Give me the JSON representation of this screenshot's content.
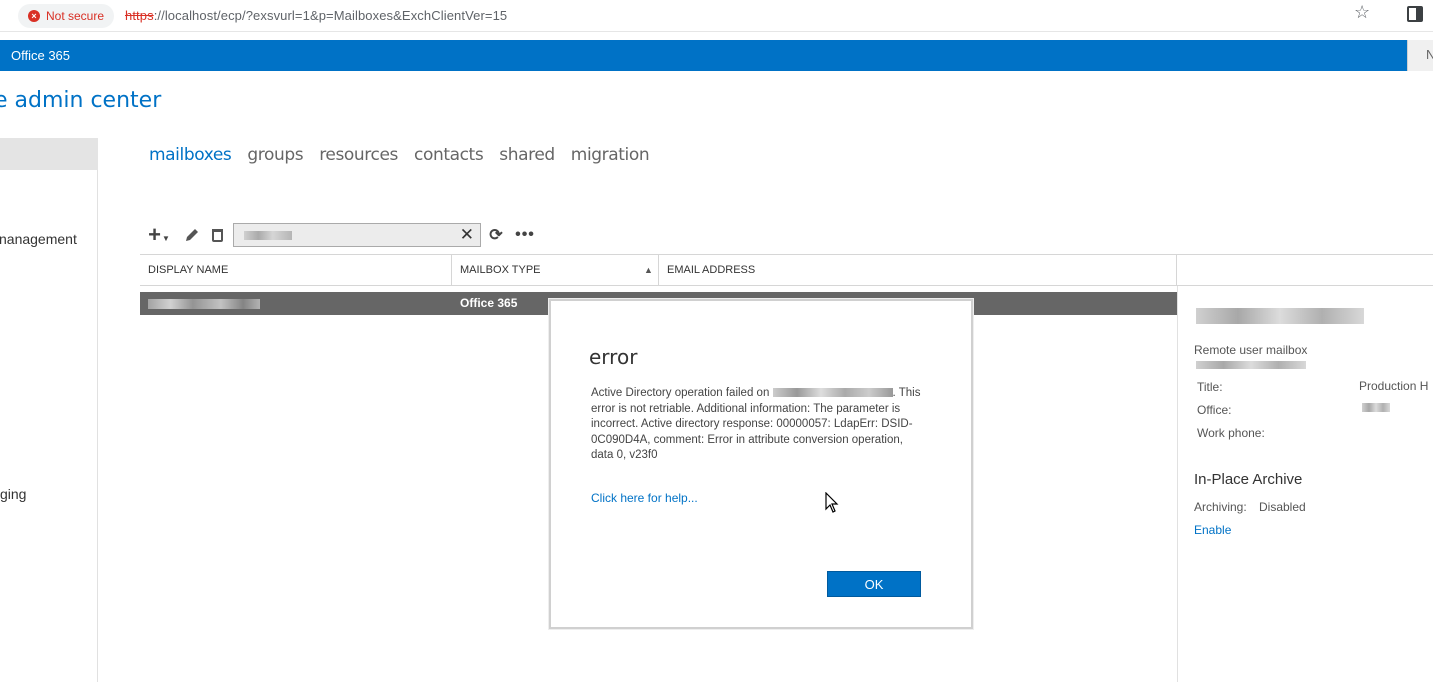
{
  "browser": {
    "security_label": "Not secure",
    "url_scheme": "https",
    "url_rest": "://localhost/ecp/?exsvurl=1&p=Mailboxes&ExchClientVer=15",
    "star_icon": "star-icon",
    "sidepanel_icon": "side-panel-icon"
  },
  "suite_bar": {
    "title": "Office 365",
    "right_label": "N"
  },
  "header": {
    "title": "e admin center"
  },
  "left_nav": {
    "items": [
      {
        "label": "nanagement"
      },
      {
        "label": "ging"
      }
    ]
  },
  "tabs": [
    {
      "label": "mailboxes",
      "active": true
    },
    {
      "label": "groups"
    },
    {
      "label": "resources"
    },
    {
      "label": "contacts"
    },
    {
      "label": "shared"
    },
    {
      "label": "migration"
    }
  ],
  "toolbar": {
    "add_icon": "plus-icon",
    "edit_icon": "pencil-icon",
    "delete_icon": "trash-icon",
    "search_value": "",
    "clear_icon": "close-icon",
    "refresh_icon": "refresh-icon",
    "more_label": "•••"
  },
  "table": {
    "columns": [
      "DISPLAY NAME",
      "MAILBOX TYPE",
      "EMAIL ADDRESS"
    ],
    "sort_indicator": "▲",
    "rows": [
      {
        "display_name": "",
        "mailbox_type": "Office 365",
        "email_address": ""
      }
    ]
  },
  "details": {
    "type": "Remote user mailbox",
    "title_label": "Title:",
    "title_value": "Production H",
    "office_label": "Office:",
    "work_phone_label": "Work phone:",
    "archive_heading": "In-Place Archive",
    "archiving_label": "Archiving:",
    "archiving_value": "Disabled",
    "enable_link": "Enable"
  },
  "dialog": {
    "title": "error",
    "message_prefix": "Active Directory operation failed on",
    "message_suffix": ". This error is not retriable. Additional information: The parameter is incorrect. Active directory response: 00000057: LdapErr: DSID-0C090D4A, comment: Error in attribute conversion operation, data 0, v23f0",
    "help_link": "Click here for help...",
    "ok_label": "OK"
  },
  "colors": {
    "accent": "#0072c6",
    "selected_row": "#666666",
    "error": "#d93025"
  }
}
